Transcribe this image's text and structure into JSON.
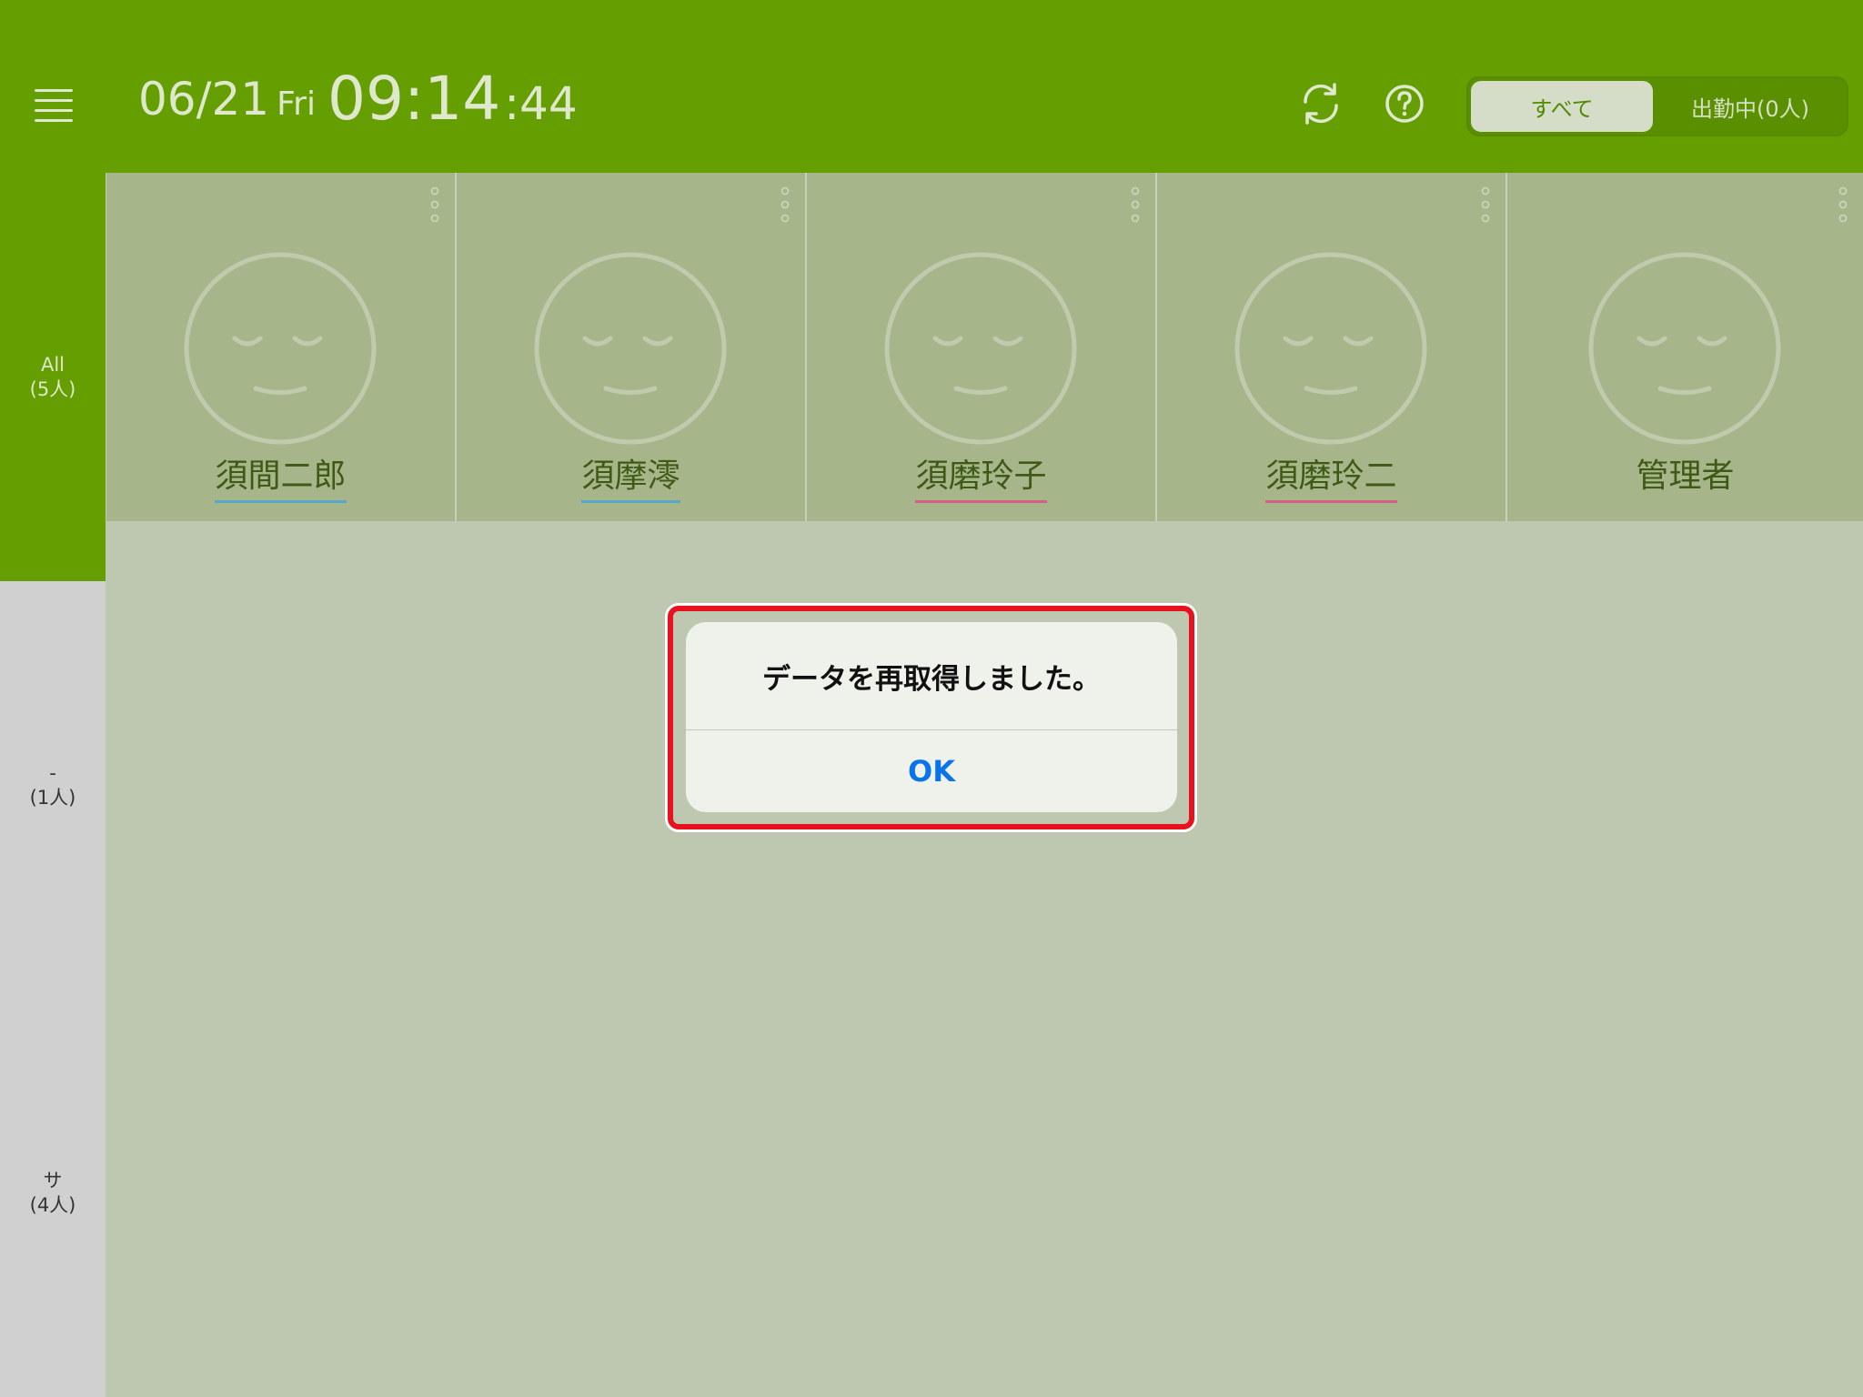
{
  "header": {
    "date": "06/21",
    "weekday": "Fri",
    "time_hm": "09:14",
    "time_sec": ":44",
    "filter": {
      "all_label": "すべて",
      "working_label": "出勤中(0人)",
      "selected": "すべて"
    },
    "icons": {
      "menu": "hamburger-menu-icon",
      "refresh": "refresh-icon",
      "help": "help-icon"
    }
  },
  "sidebar": {
    "groups": [
      {
        "name": "All",
        "count": "(5人)",
        "active": true
      },
      {
        "name": "-",
        "count": "(1人)",
        "active": false
      },
      {
        "name": "サ",
        "count": "(4人)",
        "active": false
      }
    ]
  },
  "members": [
    {
      "name": "須間二郎",
      "underline": "blue"
    },
    {
      "name": "須摩澪",
      "underline": "blue"
    },
    {
      "name": "須磨玲子",
      "underline": "red"
    },
    {
      "name": "須磨玲二",
      "underline": "red"
    },
    {
      "name": "管理者",
      "underline": "none"
    }
  ],
  "dialog": {
    "message": "データを再取得しました。",
    "ok_label": "OK"
  },
  "colors": {
    "header_green": "#649e00",
    "card_bg": "#a7b68a",
    "content_bg": "#bec7b0",
    "highlight_red": "#e8121f",
    "ok_blue": "#0a74ea"
  }
}
